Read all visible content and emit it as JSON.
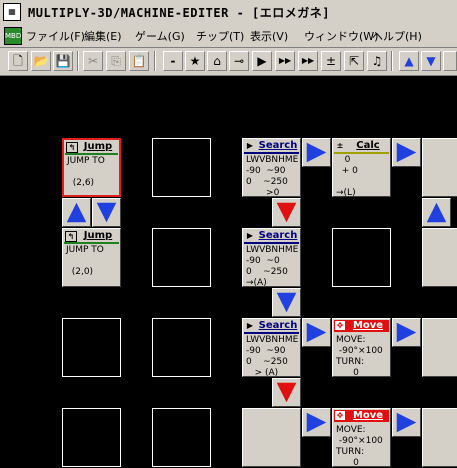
{
  "window": {
    "title": "MULTIPLY-3D/MACHINE-EDITER - [エロメガネ]",
    "icon": "app-icon"
  },
  "menu": {
    "icon": "mdi-document-icon",
    "items": [
      "ファイル(F)",
      "編集(E)",
      "ゲーム(G)",
      "チップ(T)",
      "表示(V)",
      "ウィンドウ(W)",
      "ヘルプ(H)"
    ],
    "icon_label": "MBD"
  },
  "toolbar": {
    "buttons": [
      "new-file-icon",
      "open-folder-icon",
      "save-icon",
      "cut-icon",
      "copy-icon",
      "paste-icon",
      "minus-chip-icon",
      "star-chip-icon",
      "home-chip-icon",
      "key-chip-icon",
      "play-chip-icon",
      "jump-branch-icon",
      "condition-branch-icon",
      "calc-chip-icon",
      "subroutine-icon",
      "sound-icon",
      "arrow-up-icon",
      "arrow-down-icon"
    ],
    "glyphs": [
      "🗋",
      "📂",
      "💾",
      "✂",
      "⎘",
      "📋",
      "-",
      "★",
      "⌂",
      "⊸",
      "▶",
      "▶▶",
      "▶▶",
      "±",
      "⇱",
      "♫",
      "▲",
      "▼"
    ]
  },
  "chips": {
    "jump1": {
      "name": "Jump",
      "body": "JUMP TO\n\n  (2,6)"
    },
    "jump2": {
      "name": "Jump",
      "body": "JUMP TO\n\n  (2,0)"
    },
    "search1": {
      "name": "Search",
      "body": "LWVBNHME\n-90  ~90\n0    ~250\n       >0"
    },
    "search2": {
      "name": "Search",
      "body": "LWVBNHME\n-90  ~0\n0    ~250\n→(A)"
    },
    "search3": {
      "name": "Search",
      "body": "LWVBNHME\n-90  ~90\n0    ~250\n   > (A)"
    },
    "calc1": {
      "name": "Calc",
      "body": "   0\n  + 0\n\n→(L)"
    },
    "move1": {
      "name": "Move",
      "body": "MOVE:\n -90°×100\nTURN:\n      0"
    },
    "move2": {
      "name": "Move",
      "body": "MOVE:\n -90°×100\nTURN:\n      0"
    }
  },
  "colors": {
    "arrow_blue": "#2040e0",
    "arrow_red": "#e01010",
    "chip_gray": "#d4d0c8",
    "move_header": "#e01010",
    "selected_border": "#e02020"
  }
}
